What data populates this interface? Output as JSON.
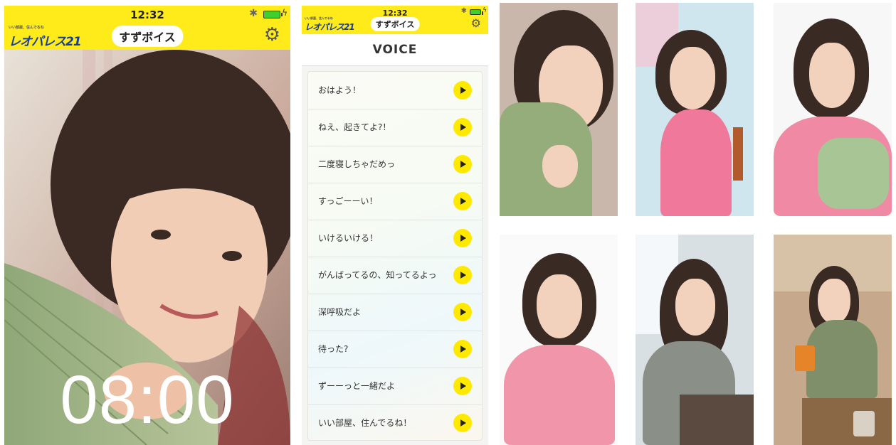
{
  "status_bar": {
    "time": "12:32"
  },
  "app": {
    "logo_text": "レオパレス21",
    "logo_tagline": "いい部屋、住んでるね",
    "title": "すずボイス",
    "settings_icon": "gear-icon"
  },
  "lock_screen": {
    "clock": "08:00"
  },
  "voice_screen": {
    "header": "VOICE",
    "items": [
      {
        "label": "おはよう！",
        "icon": "play-icon"
      },
      {
        "label": "ねえ、起きてよ?！",
        "icon": "play-icon"
      },
      {
        "label": "二度寝しちゃだめっ",
        "icon": "play-icon"
      },
      {
        "label": "すっごーーい！",
        "icon": "play-icon"
      },
      {
        "label": "いけるいける！",
        "icon": "play-icon"
      },
      {
        "label": "がんばってるの、知ってるよっ",
        "icon": "play-icon"
      },
      {
        "label": "深呼吸だよ",
        "icon": "play-icon"
      },
      {
        "label": "待った?",
        "icon": "play-icon"
      },
      {
        "label": "ずーーっと一緒だよ",
        "icon": "play-icon"
      },
      {
        "label": "いい部屋、住んでるね！",
        "icon": "play-icon"
      }
    ]
  },
  "colors": {
    "accent": "#ffe900",
    "logo_blue": "#1a3d9c",
    "clock": "#ffffff"
  }
}
